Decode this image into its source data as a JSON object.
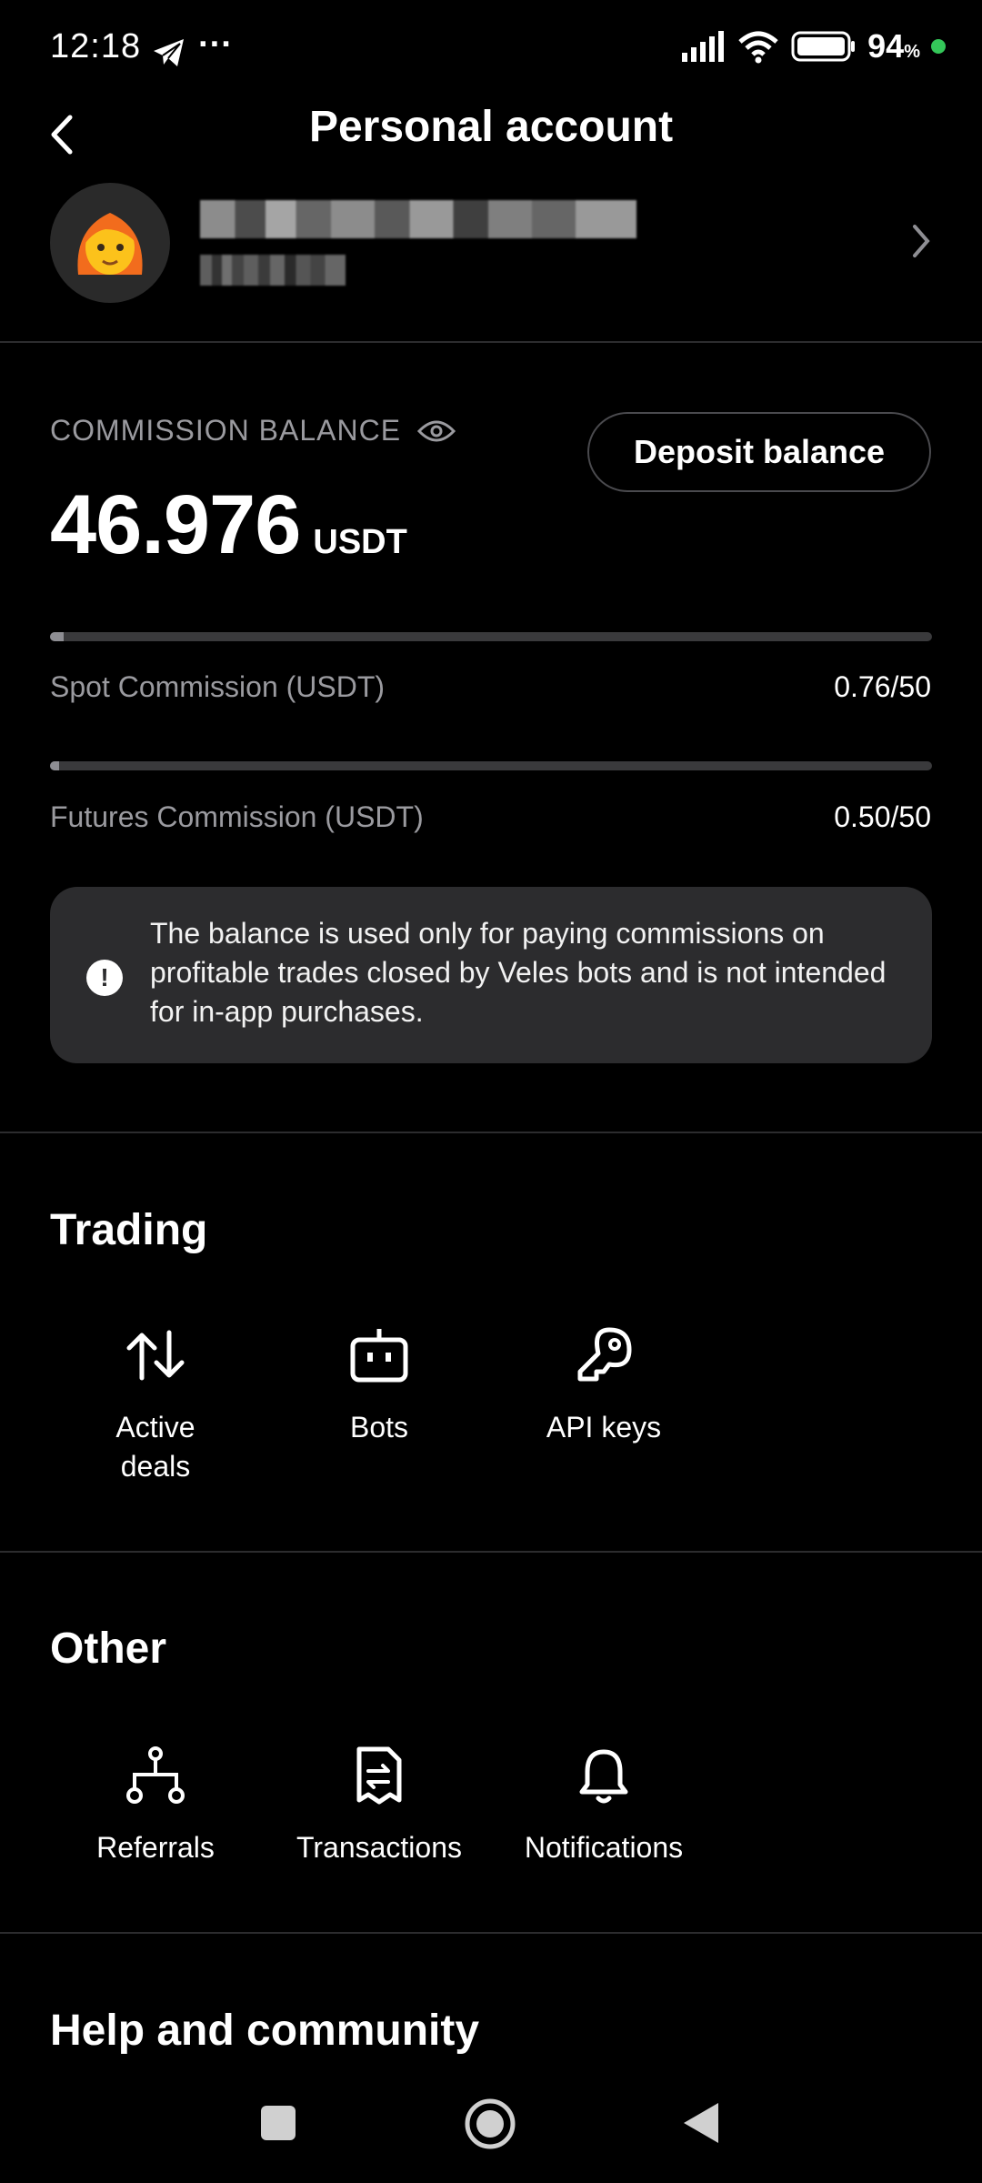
{
  "status": {
    "time": "12:18",
    "battery": "94",
    "battery_unit": "%"
  },
  "header": {
    "title": "Personal account"
  },
  "balance": {
    "label": "COMMISSION BALANCE",
    "amount": "46.976",
    "currency": "USDT",
    "deposit_label": "Deposit balance"
  },
  "commissions": [
    {
      "label": "Spot Commission (USDT)",
      "value": "0.76/50",
      "progress": 0.015
    },
    {
      "label": "Futures Commission (USDT)",
      "value": "0.50/50",
      "progress": 0.01
    }
  ],
  "info": {
    "text": "The balance is used only for paying commissions on profitable trades closed by Veles bots and is not intended for in-app purchases."
  },
  "trading": {
    "title": "Trading",
    "items": [
      {
        "label": "Active deals",
        "icon": "arrows-up-down-icon"
      },
      {
        "label": "Bots",
        "icon": "robot-icon"
      },
      {
        "label": "API keys",
        "icon": "key-icon"
      }
    ]
  },
  "other": {
    "title": "Other",
    "items": [
      {
        "label": "Referrals",
        "icon": "network-icon"
      },
      {
        "label": "Transactions",
        "icon": "receipt-icon"
      },
      {
        "label": "Notifications",
        "icon": "bell-icon"
      }
    ]
  },
  "help": {
    "title": "Help and community"
  },
  "colors": {
    "background": "#000000",
    "card": "#2c2c2e",
    "muted_text": "#9a9a9f",
    "status_dot": "#34c759"
  }
}
